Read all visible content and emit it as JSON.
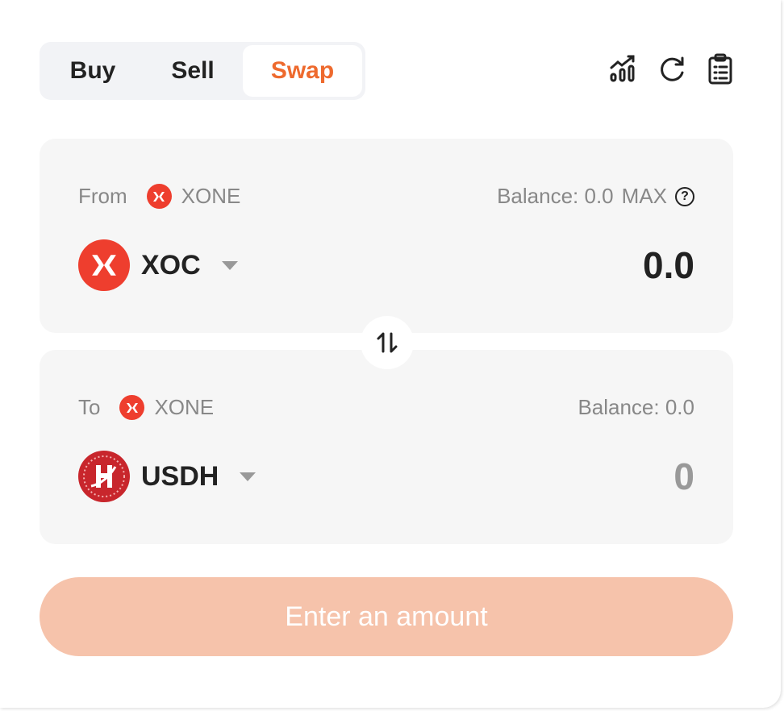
{
  "tabs": [
    {
      "label": "Buy"
    },
    {
      "label": "Sell"
    },
    {
      "label": "Swap"
    }
  ],
  "toolbar": {
    "icons": [
      "chart-icon",
      "refresh-icon",
      "clipboard-list-icon"
    ]
  },
  "from": {
    "label": "From",
    "network": "XONE",
    "balance": "Balance: 0.0",
    "max": "MAX",
    "help": "?",
    "token": "XOC",
    "amount": "0.0"
  },
  "to": {
    "label": "To",
    "network": "XONE",
    "balance": "Balance: 0.0",
    "token": "USDH",
    "amount": "0"
  },
  "submit": {
    "label": "Enter an amount"
  },
  "colors": {
    "accent": "#ee6a2e",
    "xoc": "#ee3e2e",
    "usdh": "#c8262c",
    "button": "#f6c3ab"
  }
}
